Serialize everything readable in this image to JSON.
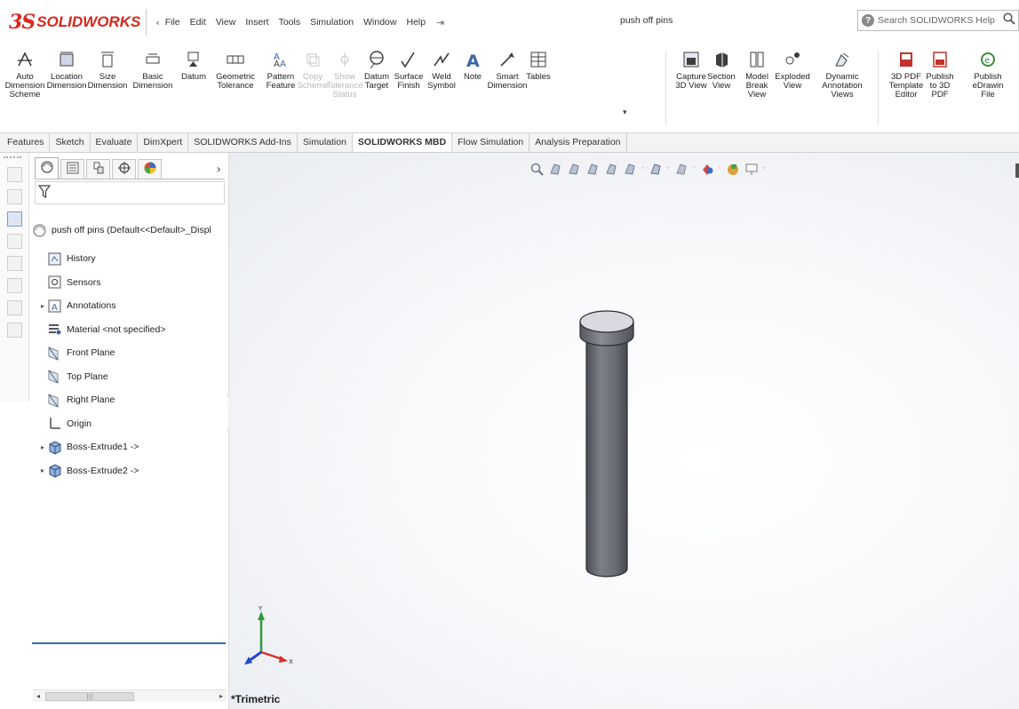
{
  "app": {
    "logo_ds": "3S",
    "logo_text": "SOLIDWORKS",
    "document_title": "push off pins"
  },
  "menu": {
    "items": [
      "File",
      "Edit",
      "View",
      "Insert",
      "Tools",
      "Simulation",
      "Window",
      "Help"
    ],
    "collapse_glyph": "‹",
    "pin_glyph": "⇥"
  },
  "search": {
    "placeholder": "Search SOLIDWORKS Help",
    "help_glyph": "?"
  },
  "ribbon": {
    "buttons": [
      {
        "label": "Auto\nDimension\nScheme",
        "icon": "auto-dimension-scheme-icon",
        "enabled": true
      },
      {
        "label": "Location\nDimension",
        "icon": "location-dimension-icon",
        "enabled": true
      },
      {
        "label": "Size\nDimension",
        "icon": "size-dimension-icon",
        "enabled": true
      },
      {
        "label": "Basic\nDimension",
        "icon": "basic-dimension-icon",
        "enabled": true
      },
      {
        "label": "Datum",
        "icon": "datum-icon",
        "enabled": true
      },
      {
        "label": "Geometric\nTolerance",
        "icon": "geometric-tolerance-icon",
        "enabled": true
      },
      {
        "label": "Pattern\nFeature",
        "icon": "pattern-feature-icon",
        "enabled": true
      },
      {
        "label": "Copy\nScheme",
        "icon": "copy-scheme-icon",
        "enabled": false
      },
      {
        "label": "Show\nTolerance\nStatus",
        "icon": "show-tolerance-status-icon",
        "enabled": false
      },
      {
        "label": "Datum\nTarget",
        "icon": "datum-target-icon",
        "enabled": true
      },
      {
        "label": "Surface\nFinish",
        "icon": "surface-finish-icon",
        "enabled": true
      },
      {
        "label": "Weld\nSymbol",
        "icon": "weld-symbol-icon",
        "enabled": true
      },
      {
        "label": "Note",
        "icon": "note-icon",
        "enabled": true
      },
      {
        "label": "Smart\nDimension",
        "icon": "smart-dimension-icon",
        "enabled": true
      },
      {
        "label": "Tables",
        "icon": "tables-icon",
        "enabled": true
      },
      {
        "label": "Capture\n3D View",
        "icon": "capture-3d-view-icon",
        "enabled": true
      },
      {
        "label": "Section\nView",
        "icon": "section-view-icon",
        "enabled": true
      },
      {
        "label": "Model\nBreak\nView",
        "icon": "model-break-view-icon",
        "enabled": true
      },
      {
        "label": "Exploded\nView",
        "icon": "exploded-view-icon",
        "enabled": true
      },
      {
        "label": "Dynamic\nAnnotation\nViews",
        "icon": "dynamic-annotation-views-icon",
        "enabled": true
      },
      {
        "label": "3D PDF\nTemplate\nEditor",
        "icon": "3d-pdf-template-editor-icon",
        "enabled": true
      },
      {
        "label": "Publish\nto 3D\nPDF",
        "icon": "publish-3d-pdf-icon",
        "enabled": true
      },
      {
        "label": "Publish\neDrawin\nFile",
        "icon": "publish-edrawings-icon",
        "enabled": true
      }
    ],
    "tables_dropdown_glyph": "▾"
  },
  "command_tabs": {
    "items": [
      "Features",
      "Sketch",
      "Evaluate",
      "DimXpert",
      "SOLIDWORKS Add-Ins",
      "Simulation",
      "SOLIDWORKS MBD",
      "Flow Simulation",
      "Analysis Preparation"
    ],
    "active": "SOLIDWORKS MBD"
  },
  "panel": {
    "tabs": [
      "feature-manager-icon",
      "property-manager-icon",
      "configuration-manager-icon",
      "dimxpert-manager-icon",
      "display-manager-icon"
    ],
    "more_glyph": "›",
    "tree": [
      {
        "label": "push off pins  (Default<<Default>_Displ",
        "icon": "part-icon",
        "indent": 0,
        "expander": ""
      },
      {
        "label": "History",
        "icon": "history-icon",
        "indent": 1,
        "expander": ""
      },
      {
        "label": "Sensors",
        "icon": "sensors-icon",
        "indent": 1,
        "expander": ""
      },
      {
        "label": "Annotations",
        "icon": "annotations-icon",
        "indent": 1,
        "expander": "▸"
      },
      {
        "label": "Material <not specified>",
        "icon": "material-icon",
        "indent": 1,
        "expander": ""
      },
      {
        "label": "Front Plane",
        "icon": "plane-icon",
        "indent": 1,
        "expander": ""
      },
      {
        "label": "Top Plane",
        "icon": "plane-icon",
        "indent": 1,
        "expander": ""
      },
      {
        "label": "Right Plane",
        "icon": "plane-icon",
        "indent": 1,
        "expander": ""
      },
      {
        "label": "Origin",
        "icon": "origin-icon",
        "indent": 1,
        "expander": ""
      },
      {
        "label": "Boss-Extrude1 ->",
        "icon": "boss-extrude-icon",
        "indent": 1,
        "expander": "▸"
      },
      {
        "label": "Boss-Extrude2 ->",
        "icon": "boss-extrude-icon",
        "indent": 1,
        "expander": "▸"
      }
    ],
    "scroll_thumb_glyph": "|||",
    "scroll_left_glyph": "◂",
    "scroll_right_glyph": "▸"
  },
  "viewport": {
    "view_orientation": "*Trimetric",
    "triad": {
      "x": "X",
      "y": "Y"
    },
    "model_color": "#6f7278",
    "headsup_icons": [
      "zoom-to-fit-icon",
      "zoom-to-area-icon",
      "previous-view-icon",
      "section-view-icon",
      "dynamic-annotation-icon",
      "view-orientation-icon",
      "display-style-icon",
      "hide-show-items-icon",
      "edit-appearance-icon",
      "apply-scene-icon",
      "view-settings-icon"
    ]
  }
}
